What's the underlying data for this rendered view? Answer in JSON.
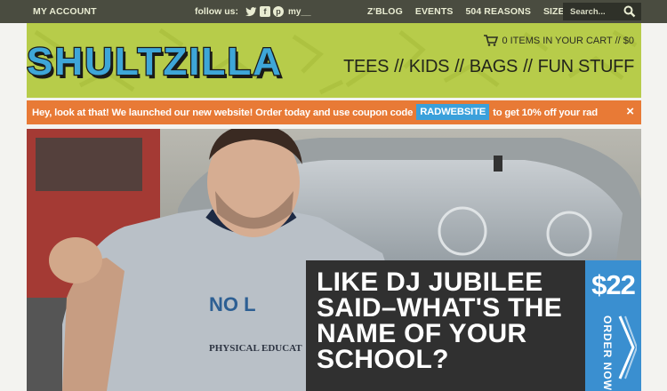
{
  "topbar": {
    "account_label": "MY ACCOUNT",
    "follow_label": "follow us:",
    "social": [
      {
        "name": "twitter-icon",
        "glyph": "🐦"
      },
      {
        "name": "facebook-icon",
        "glyph": "f"
      },
      {
        "name": "pinterest-icon",
        "glyph": "p"
      },
      {
        "name": "myspace-icon",
        "glyph": "my__"
      }
    ],
    "nav": [
      "Z'BLOG",
      "EVENTS",
      "504 REASONS",
      "SIZE CHART"
    ],
    "search_placeholder": "Search..."
  },
  "header": {
    "logo_text": "SHULTZILLA",
    "cart_text": "0 ITEMS IN YOUR CART // $0",
    "nav": [
      "TEES",
      "KIDS",
      "BAGS",
      "FUN STUFF"
    ],
    "nav_separator": "//"
  },
  "promo": {
    "text_before": "Hey, look at that! We launched our new website! Order today and use coupon code",
    "code": "RADWEBSITE",
    "text_after": "to get 10% off your rad",
    "close": "×"
  },
  "hero": {
    "shirt_text": "NO L",
    "shirt_subtext": "PHYSICAL EDUCAT",
    "headline": "LIKE DJ JUBILEE\nSAID–WHAT'S THE\nNAME OF YOUR\nSCHOOL?",
    "price": "$22",
    "cta": "ORDER NOW"
  },
  "colors": {
    "topbar": "#4a4c40",
    "header": "#b7cc4a",
    "promo": "#e87a36",
    "coupon": "#3aa0db",
    "price_box": "#3a8fd0",
    "headline_box": "#303030"
  }
}
